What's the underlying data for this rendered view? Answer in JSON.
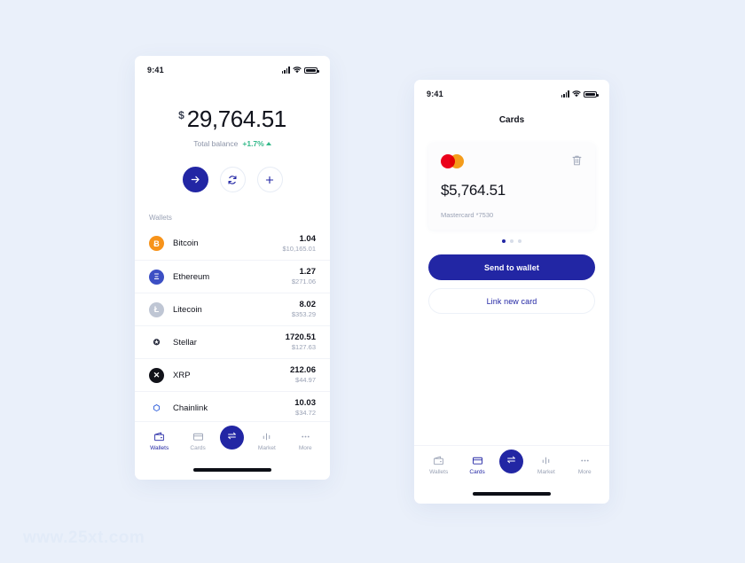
{
  "theme": {
    "accent": "#2226a4",
    "background": "#eaf0fa",
    "positive": "#34b98a",
    "muted": "#9aa2b5"
  },
  "watermark": "www.25xt.com",
  "wallets_screen": {
    "status_bar": {
      "time": "9:41",
      "signal_icon": "signal-bars-icon",
      "wifi_icon": "wifi-icon",
      "battery_icon": "battery-icon"
    },
    "balance": {
      "currency_symbol": "$",
      "amount": "29,764.51",
      "caption": "Total balance",
      "change": "+1.7%",
      "change_direction_icon": "caret-up-icon"
    },
    "actions": [
      {
        "name": "send",
        "icon": "arrow-right-icon",
        "primary": true
      },
      {
        "name": "swap",
        "icon": "refresh-icon",
        "primary": false
      },
      {
        "name": "add",
        "icon": "plus-icon",
        "primary": false
      }
    ],
    "list_label": "Wallets",
    "wallets": [
      {
        "name": "Bitcoin",
        "qty": "1.04",
        "usd": "$10,165.01",
        "symbol": "Ƀ",
        "color": "#f7931a",
        "text_color": "#ffffff",
        "icon": "bitcoin-icon"
      },
      {
        "name": "Ethereum",
        "qty": "1.27",
        "usd": "$271.06",
        "symbol": "Ξ",
        "color": "#3c4fc4",
        "text_color": "#ffffff",
        "icon": "ethereum-icon"
      },
      {
        "name": "Litecoin",
        "qty": "8.02",
        "usd": "$353.29",
        "symbol": "Ł",
        "color": "#bfc6d4",
        "text_color": "#ffffff",
        "icon": "litecoin-icon"
      },
      {
        "name": "Stellar",
        "qty": "1720.51",
        "usd": "$127.63",
        "symbol": "✪",
        "color": "#ffffff",
        "text_color": "#2d3142",
        "icon": "stellar-icon"
      },
      {
        "name": "XRP",
        "qty": "212.06",
        "usd": "$44.97",
        "symbol": "✕",
        "color": "#12131a",
        "text_color": "#ffffff",
        "icon": "xrp-icon"
      },
      {
        "name": "Chainlink",
        "qty": "10.03",
        "usd": "$34.72",
        "symbol": "⬡",
        "color": "#ffffff",
        "text_color": "#2a5ada",
        "icon": "chainlink-icon"
      }
    ],
    "tabs": [
      {
        "label": "Wallets",
        "icon": "wallet-icon",
        "active": true
      },
      {
        "label": "Cards",
        "icon": "card-icon",
        "active": false
      },
      {
        "label": "Market",
        "icon": "chart-bars-icon",
        "active": false
      },
      {
        "label": "More",
        "icon": "ellipsis-icon",
        "active": false
      }
    ],
    "fab": {
      "icon": "swap-arrows-icon",
      "name": "swap-fab"
    }
  },
  "cards_screen": {
    "status_bar": {
      "time": "9:41",
      "signal_icon": "signal-bars-icon",
      "wifi_icon": "wifi-icon",
      "battery_icon": "battery-icon"
    },
    "title": "Cards",
    "card": {
      "brand_icon": "mastercard-icon",
      "delete_icon": "trash-icon",
      "amount": "$5,764.51",
      "label": "Mastercard *7530"
    },
    "pager": {
      "count": 3,
      "active_index": 0
    },
    "buttons": {
      "primary": "Send to wallet",
      "secondary": "Link new card"
    },
    "tabs": [
      {
        "label": "Wallets",
        "icon": "wallet-icon",
        "active": false
      },
      {
        "label": "Cards",
        "icon": "card-icon",
        "active": true
      },
      {
        "label": "Market",
        "icon": "chart-bars-icon",
        "active": false
      },
      {
        "label": "More",
        "icon": "ellipsis-icon",
        "active": false
      }
    ],
    "fab": {
      "icon": "swap-arrows-icon",
      "name": "swap-fab"
    }
  }
}
